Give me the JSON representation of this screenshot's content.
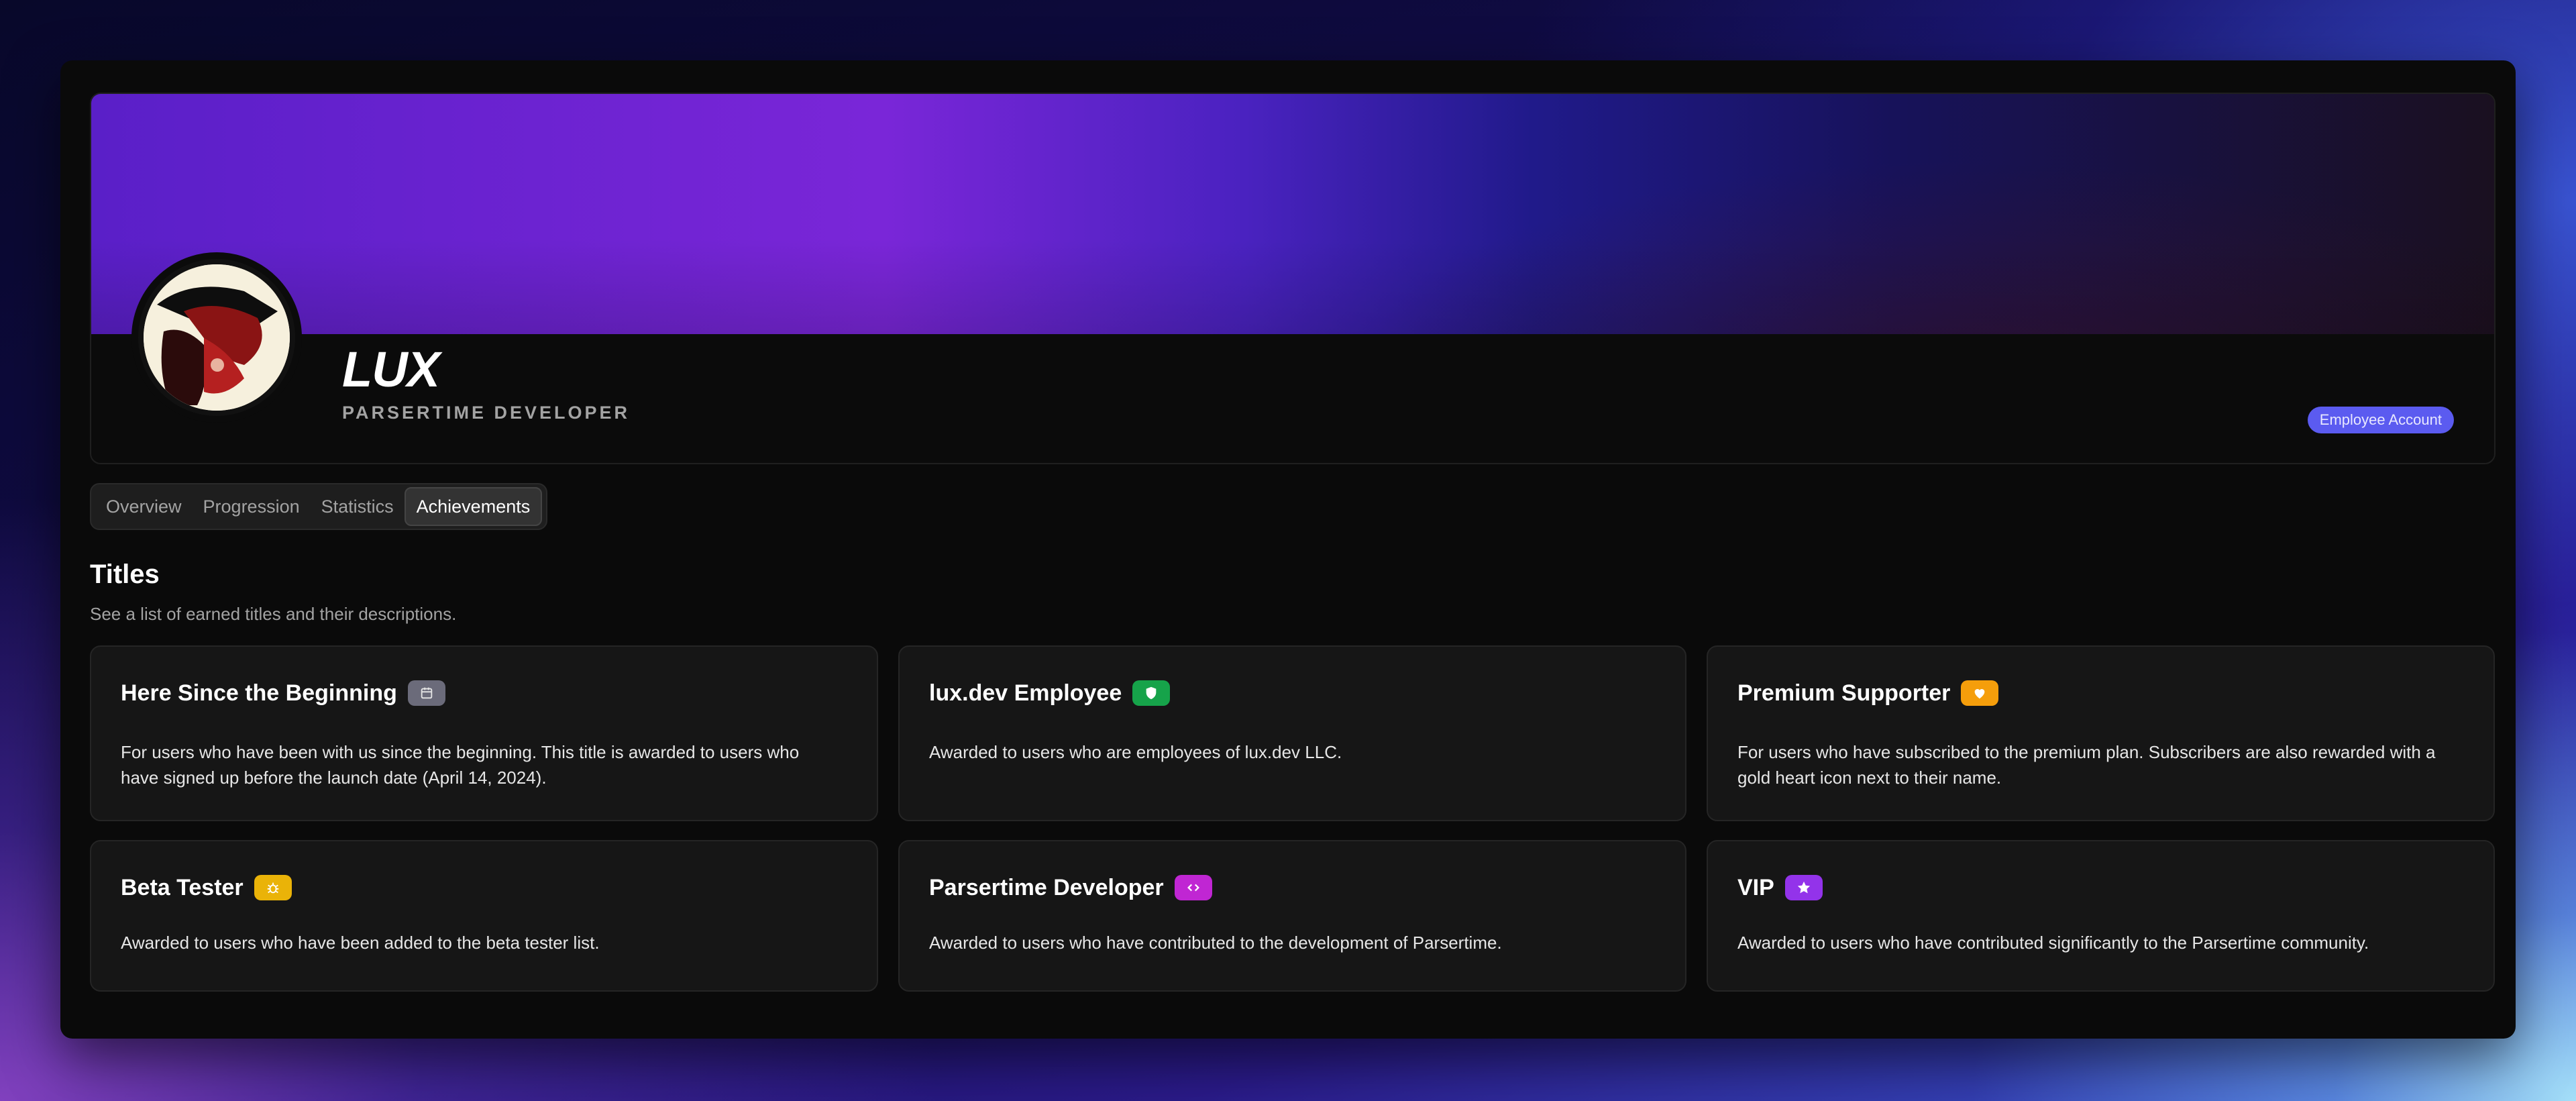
{
  "profile": {
    "name": "LUX",
    "role": "PARSERTIME DEVELOPER",
    "badge": "Employee Account"
  },
  "tabs": [
    {
      "label": "Overview"
    },
    {
      "label": "Progression"
    },
    {
      "label": "Statistics"
    },
    {
      "label": "Achievements",
      "active": true
    }
  ],
  "section": {
    "title": "Titles",
    "subtitle": "See a list of earned titles and their descriptions."
  },
  "titles": [
    {
      "title": "Here Since the Beginning",
      "icon": "calendar-icon",
      "color": "#6b6b7a",
      "desc": "For users who have been with us since the beginning. This title is awarded to users who have signed up before the launch date (April 14, 2024)."
    },
    {
      "title": "lux.dev Employee",
      "icon": "shield-icon",
      "color": "#16a34a",
      "desc": "Awarded to users who are employees of lux.dev LLC."
    },
    {
      "title": "Premium Supporter",
      "icon": "heart-icon",
      "color": "#f59e0b",
      "desc": "For users who have subscribed to the premium plan. Subscribers are also rewarded with a gold heart icon next to their name."
    },
    {
      "title": "Beta Tester",
      "icon": "bug-icon",
      "color": "#eab308",
      "desc": "Awarded to users who have been added to the beta tester list."
    },
    {
      "title": "Parsertime Developer",
      "icon": "code-icon",
      "color": "#c026d3",
      "desc": "Awarded to users who have contributed to the development of Parsertime."
    },
    {
      "title": "VIP",
      "icon": "star-icon",
      "color": "#9333ea",
      "desc": "Awarded to users who have contributed significantly to the Parsertime community."
    }
  ]
}
